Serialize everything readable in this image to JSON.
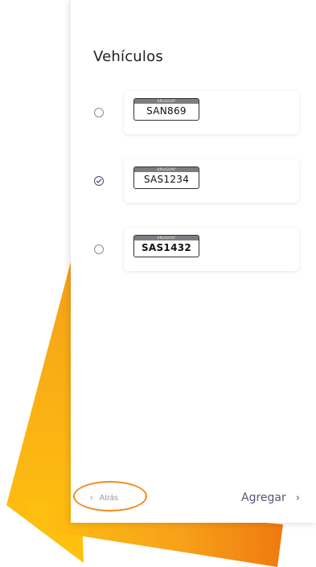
{
  "page": {
    "title": "Vehículos"
  },
  "vehicles": [
    {
      "plate_header": "URUGUAY",
      "plate_number": "SAN869",
      "selected": false
    },
    {
      "plate_header": "URUGUAY",
      "plate_number": "SAS1234",
      "selected": true
    },
    {
      "plate_header": "URUGUAY",
      "plate_number": "SAS1432",
      "selected": false
    }
  ],
  "footer": {
    "back_label": "Atrás",
    "back_chevron": "‹",
    "add_label": "Agregar",
    "add_chevron": "›"
  },
  "icons": {
    "selected_radio": "check-circle-icon",
    "unselected_radio": "radio-empty-icon",
    "back": "chevron-left-icon",
    "forward": "chevron-right-icon"
  },
  "colors": {
    "accent_orange": "#f08a1e",
    "accent_yellow": "#ffc20e",
    "link_color": "#55557a",
    "muted": "#9a9aa2"
  }
}
